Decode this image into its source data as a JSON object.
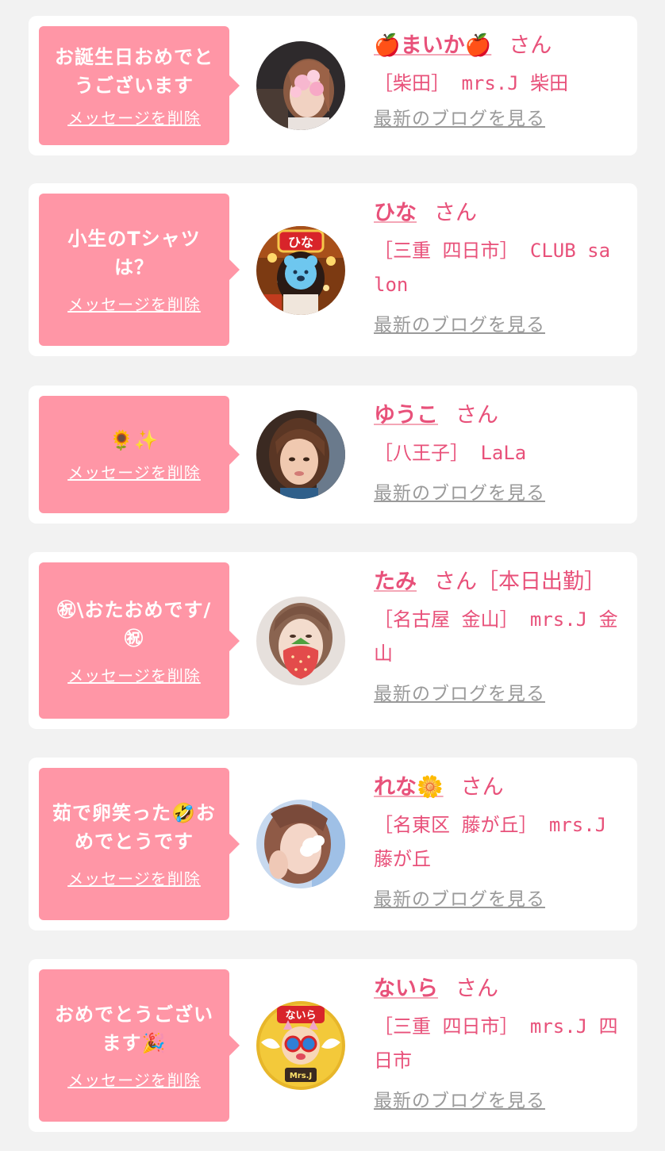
{
  "messages": [
    {
      "text": "お誕生日おめでとうございます",
      "delete_label": "メッセージを削除",
      "name": "🍎まいか🍎",
      "honorific": "さん",
      "extra": "",
      "shop": "［柴田］ mrs.J 柴田",
      "blog_label": "最新のブログを見る"
    },
    {
      "text": "小生のTシャツは？",
      "delete_label": "メッセージを削除",
      "name": "ひな",
      "honorific": "さん",
      "extra": "",
      "shop": "［三重 四日市］ CLUB salon",
      "blog_label": "最新のブログを見る"
    },
    {
      "text": "🌻✨",
      "delete_label": "メッセージを削除",
      "name": "ゆうこ",
      "honorific": "さん",
      "extra": "",
      "shop": "［八王子］ LaLa",
      "blog_label": "最新のブログを見る"
    },
    {
      "text": "㊗\\おたおめです/㊗",
      "delete_label": "メッセージを削除",
      "name": "たみ",
      "honorific": "さん",
      "extra": "［本日出勤］",
      "shop": "［名古屋 金山］ mrs.J 金山",
      "blog_label": "最新のブログを見る"
    },
    {
      "text": "茹で卵笑った🤣おめでとうです",
      "delete_label": "メッセージを削除",
      "name": "れな🌼",
      "honorific": "さん",
      "extra": "",
      "shop": "［名東区 藤が丘］ mrs.J 藤が丘",
      "blog_label": "最新のブログを見る"
    },
    {
      "text": "おめでとうございます🎉",
      "delete_label": "メッセージを削除",
      "name": "ないら",
      "honorific": "さん",
      "extra": "",
      "shop": "［三重 四日市］ mrs.J 四日市",
      "blog_label": "最新のブログを見る"
    }
  ],
  "avatar_texts": {
    "hina_badge": "ひな",
    "naira_badge": "ないら",
    "naira_sign": "Mrs.J"
  },
  "colors": {
    "page_background": "#f2f2f2",
    "card_background": "#ffffff",
    "bubble": "#ff96a6",
    "accent": "#e8517a",
    "muted_link": "#9a9a9a"
  }
}
